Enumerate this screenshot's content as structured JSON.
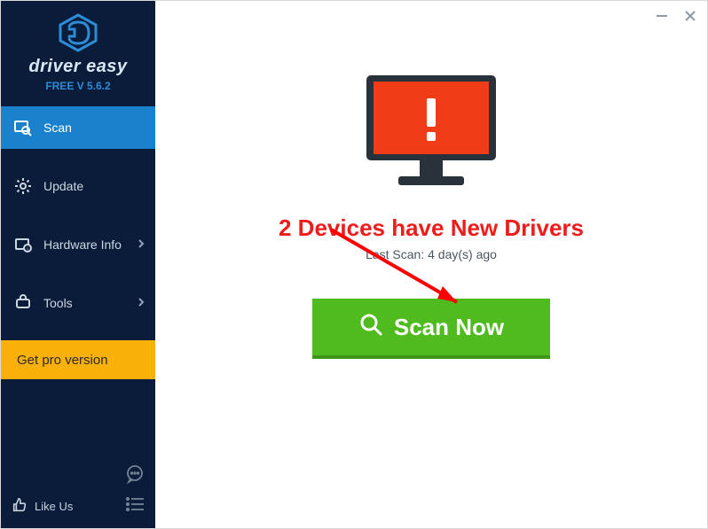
{
  "brand": {
    "name": "driver easy",
    "version": "FREE V 5.6.2"
  },
  "sidebar": {
    "items": [
      {
        "label": "Scan"
      },
      {
        "label": "Update"
      },
      {
        "label": "Hardware Info"
      },
      {
        "label": "Tools"
      }
    ],
    "pro_label": "Get pro version",
    "like_label": "Like Us"
  },
  "main": {
    "headline": "2 Devices have New Drivers",
    "last_scan": "Last Scan: 4 day(s) ago",
    "scan_button": "Scan Now"
  },
  "colors": {
    "accent_red": "#ef1c1c",
    "scan_green": "#4fbb1e",
    "sidebar_bg": "#0a1c39",
    "active_nav": "#1a81cc",
    "pro_yellow": "#f9b109"
  }
}
